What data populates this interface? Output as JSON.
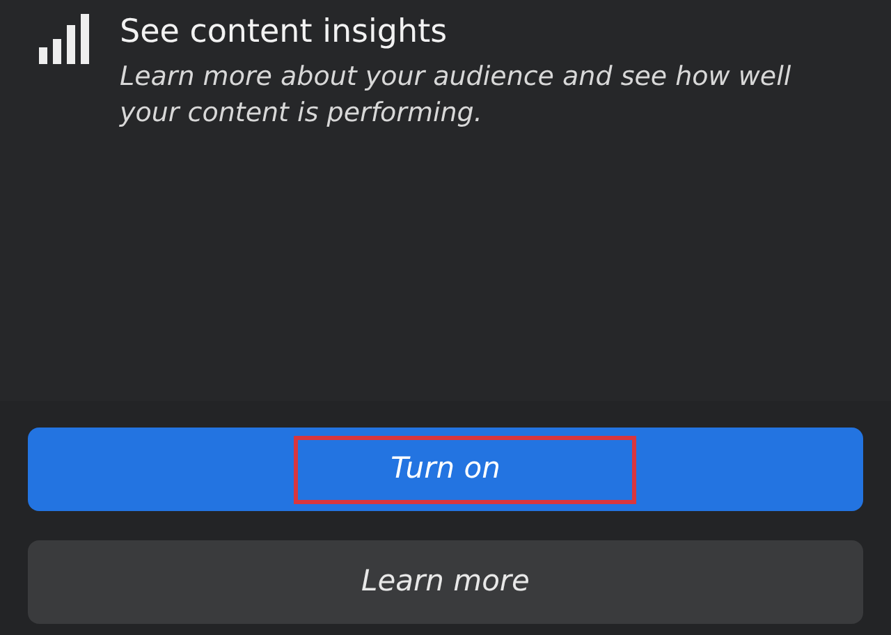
{
  "insights": {
    "title": "See content insights",
    "description": "Learn more about your audience and see how well your content is performing."
  },
  "buttons": [
    {
      "label": "Turn on",
      "kind": "primary",
      "highlighted": true
    },
    {
      "label": "Learn more",
      "kind": "secondary",
      "highlighted": false
    }
  ]
}
